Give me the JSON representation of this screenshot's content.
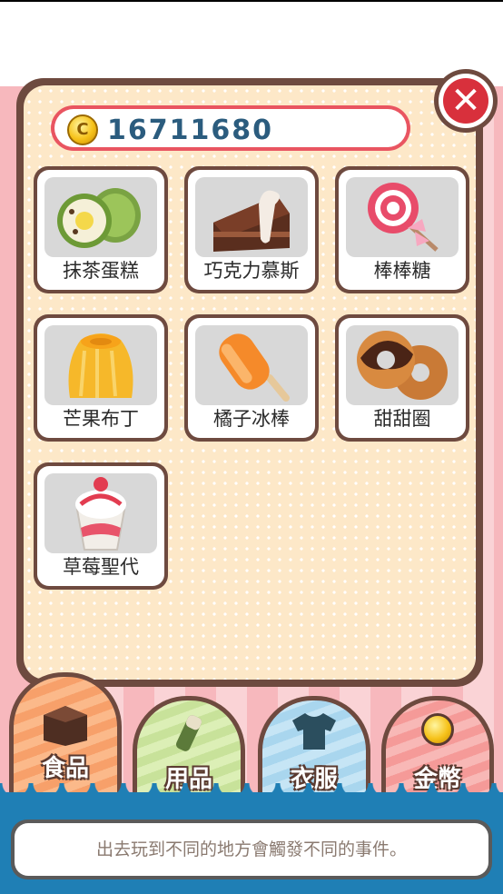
{
  "wallet": {
    "coins": "16711680",
    "coin_icon": "coin-icon",
    "coin_letter": "C"
  },
  "close_glyph": "✕",
  "items": [
    {
      "label": "抹茶蛋糕",
      "icon": "matcha-roll-cake"
    },
    {
      "label": "巧克力慕斯",
      "icon": "chocolate-mousse-cake"
    },
    {
      "label": "棒棒糖",
      "icon": "lollipop"
    },
    {
      "label": "芒果布丁",
      "icon": "mango-pudding"
    },
    {
      "label": "橘子冰棒",
      "icon": "orange-popsicle"
    },
    {
      "label": "甜甜圈",
      "icon": "donut"
    },
    {
      "label": "草莓聖代",
      "icon": "strawberry-sundae"
    }
  ],
  "tabs": [
    {
      "label": "食品",
      "icon": "food-box-icon",
      "color": "#f7a06a",
      "active": true
    },
    {
      "label": "用品",
      "icon": "supplies-icon",
      "color": "#c8e29a",
      "active": false
    },
    {
      "label": "衣服",
      "icon": "shirt-icon",
      "color": "#a9d6ee",
      "active": false
    },
    {
      "label": "金幣",
      "icon": "gold-coin-icon",
      "color": "#f59a98",
      "active": false
    }
  ],
  "hint": "出去玩到不同的地方會觸發不同的事件。",
  "colors": {
    "frame": "#6e4a3f",
    "coin_bar": "#e95561",
    "coin_text": "#2b5c7e",
    "close": "#d8303c",
    "sea": "#1f7fb5"
  }
}
